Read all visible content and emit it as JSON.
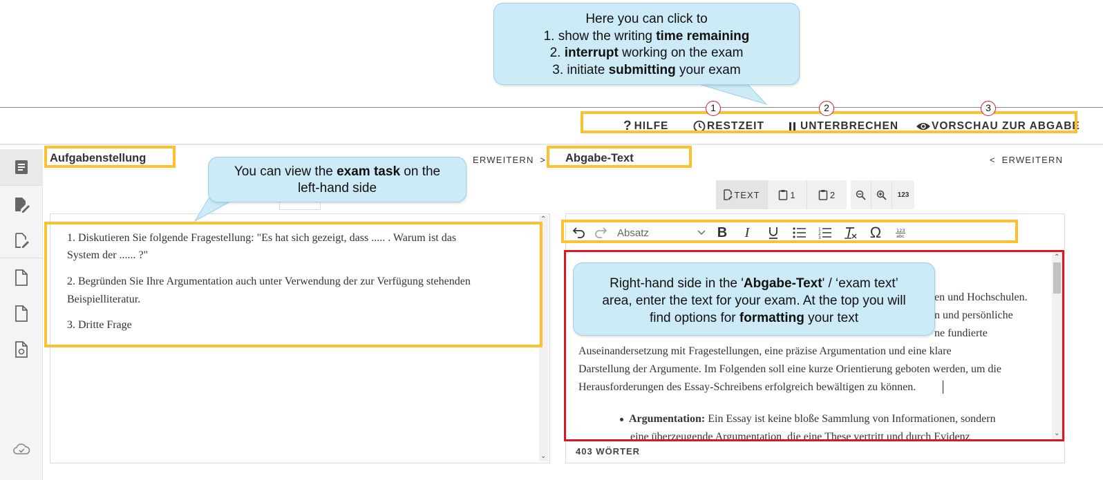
{
  "callouts": {
    "top": {
      "line1": "Here you can click to",
      "l2a": "1. show the writing ",
      "l2b": "time remaining",
      "l3a": "2. ",
      "l3b": "interrupt",
      "l3c": " working on the exam",
      "l4a": "3. initiate ",
      "l4b": "submitting",
      "l4c": " your exam"
    },
    "left": {
      "a": "You can view the ",
      "b": "exam task",
      "c": " on the",
      "d": "left-hand side"
    },
    "right": {
      "l1a": "Right-hand side in the '",
      "l1b": "Abgabe-Text",
      "l1c": "' / ‘exam text’",
      "l2": "area, enter the text for your exam. At the top you will",
      "l3a": "find options for ",
      "l3b": "formatting",
      "l3c": " your text"
    }
  },
  "topnav": {
    "help": "HILFE",
    "time": "RESTZEIT",
    "interrupt": "UNTERBRECHEN",
    "preview": "VORSCHAU ZUR ABGABE"
  },
  "badges": [
    "1",
    "2",
    "3"
  ],
  "left_pane": {
    "title": "Aufgabenstellung",
    "expand": "ERWEITERN",
    "expand_arrow": ">",
    "tasks": [
      "1. Diskutieren Sie folgende Fragestellung: \"Es hat sich gezeigt, dass ..... . Warum ist das",
      "System der ......   ?\"",
      "2. Begründen Sie Ihre Argumentation auch unter Verwendung der zur Verfügung stehenden",
      "Beispielliteratur.",
      "3. Dritte Frage"
    ]
  },
  "right_pane": {
    "title": "Abgabe-Text",
    "expand": "ERWEITERN",
    "expand_arrow": "<",
    "modes": {
      "text": "TEXT",
      "clip1": "1",
      "clip2": "2",
      "num": "123"
    },
    "toolbar": {
      "paragraph": "Absatz"
    },
    "essay": {
      "frag1": "en und Hochschulen.",
      "frag2": "n und persönliche",
      "frag3": "ne fundierte",
      "line4": "Auseinandersetzung mit Fragestellungen, eine präzise Argumentation und eine klare",
      "line5": "Darstellung der Argumente. Im Folgenden soll eine kurze Orientierung geboten werden, um die",
      "line6": "Herausforderungen des Essay-Schreibens erfolgreich bewältigen zu können.",
      "bullet_bold": "Argumentation:",
      "bullet_text": " Ein Essay ist keine bloße Sammlung von Informationen, sondern",
      "bullet_line2": "eine überzeugende Argumentation, die eine These vertritt und durch Evidenz"
    },
    "word_count": "403 WÖRTER"
  },
  "colors": {
    "highlight": "#fdc02f",
    "red": "#e0161f",
    "callout": "#cdeaf7"
  }
}
